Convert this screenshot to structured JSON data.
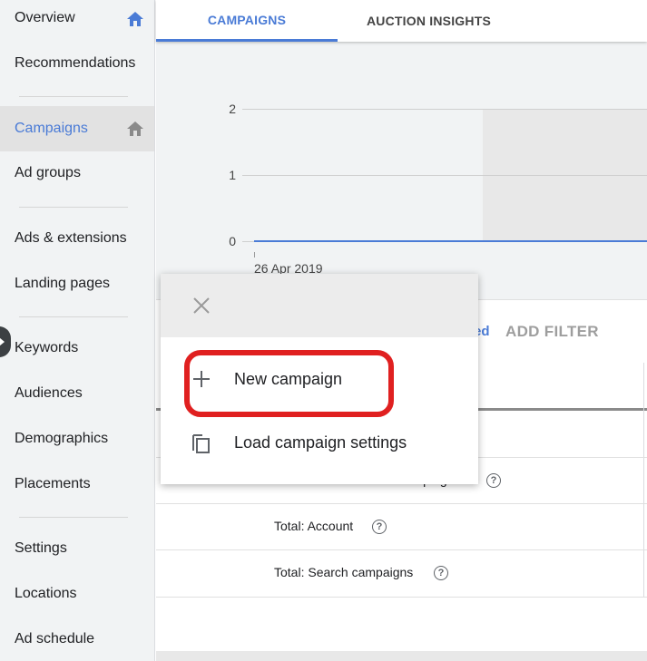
{
  "sidebar": {
    "items": [
      {
        "label": "Overview"
      },
      {
        "label": "Recommendations"
      },
      {
        "label": "Campaigns"
      },
      {
        "label": "Ad groups"
      },
      {
        "label": "Ads & extensions"
      },
      {
        "label": "Landing pages"
      },
      {
        "label": "Keywords"
      },
      {
        "label": "Audiences"
      },
      {
        "label": "Demographics"
      },
      {
        "label": "Placements"
      },
      {
        "label": "Settings"
      },
      {
        "label": "Locations"
      },
      {
        "label": "Ad schedule"
      }
    ]
  },
  "tabs": [
    {
      "label": "CAMPAIGNS"
    },
    {
      "label": "AUCTION INSIGHTS"
    }
  ],
  "chart": {
    "y_ticks": [
      "2",
      "1",
      "0"
    ],
    "x_tick": "26 Apr 2019"
  },
  "filter_bar": {
    "partial_label": "ed",
    "add_filter": "ADD FILTER"
  },
  "table": {
    "rows": [
      {
        "label": "Total: All but removed campaigns"
      },
      {
        "label": "Total: Account"
      },
      {
        "label": "Total: Search campaigns"
      }
    ],
    "help_glyph": "?"
  },
  "popup": {
    "items": [
      {
        "label": "New campaign"
      },
      {
        "label": "Load campaign settings"
      }
    ]
  },
  "colors": {
    "accent": "#4a7bd6",
    "highlight": "#e02020"
  }
}
